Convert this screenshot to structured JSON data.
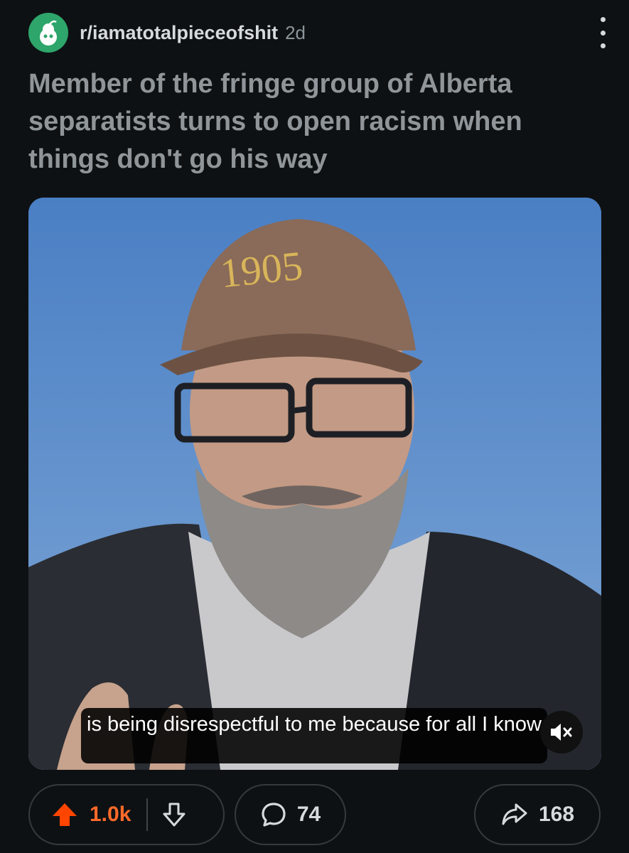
{
  "post": {
    "subreddit": "r/iamatotalpieceofshit",
    "age": "2d",
    "title": "Member of the fringe group of Alberta separatists turns to open racism when things don't go his way"
  },
  "video": {
    "hat_text": "1905",
    "caption": "is being disrespectful to me because for all I know"
  },
  "actions": {
    "upvotes": "1.0k",
    "comments": "74",
    "shares": "168"
  },
  "colors": {
    "background": "#0e1113",
    "upvote_accent": "#ff6a2a",
    "avatar": "#2ea56b",
    "title": "#8f9599"
  },
  "icons": [
    "subreddit-avatar-icon",
    "more-options-icon",
    "mute-icon",
    "upvote-icon",
    "downvote-icon",
    "comment-icon",
    "share-icon"
  ]
}
